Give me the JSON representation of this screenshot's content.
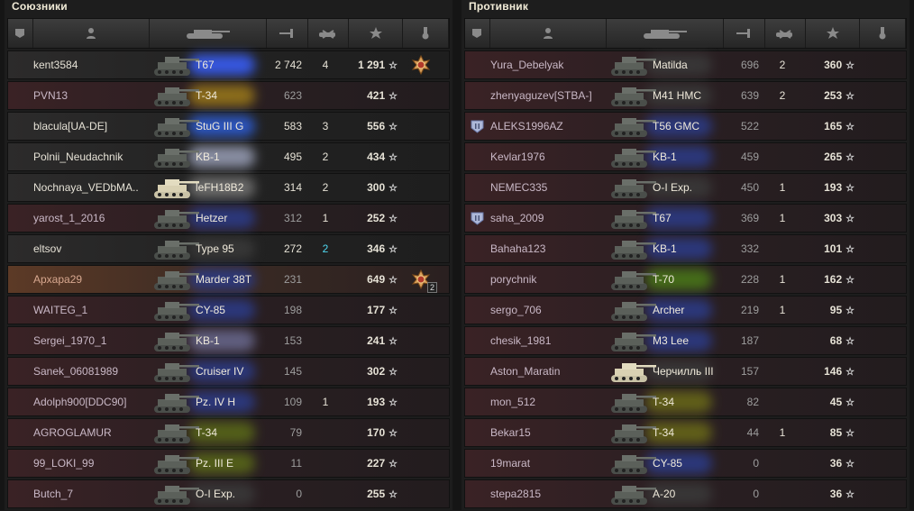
{
  "allies": {
    "title": "Союзники",
    "players": [
      {
        "name": "kent3584",
        "tank": "T67",
        "damage": "2 742",
        "frags": "4",
        "exp": "1 291",
        "style": "dark",
        "glow": "#3a60ff",
        "medal": "order",
        "medal_count": ""
      },
      {
        "name": "PVN13",
        "tank": "T-34",
        "damage": "623",
        "frags": "",
        "exp": "421",
        "style": "alt",
        "glow": "#9c7a1a",
        "medal": "",
        "medal_count": ""
      },
      {
        "name": "blacula[UA-DE]",
        "tank": "StuG III G",
        "damage": "583",
        "frags": "3",
        "exp": "556",
        "style": "dark",
        "glow": "#2e5ed8",
        "medal": "",
        "medal_count": ""
      },
      {
        "name": "Polnii_Neudachnik",
        "tank": "KB-1",
        "damage": "495",
        "frags": "2",
        "exp": "434",
        "style": "dark",
        "glow": "#9aa0b8",
        "medal": "",
        "medal_count": ""
      },
      {
        "name": "Nochnaya_VEDbMA..",
        "tank": "leFH18B2",
        "damage": "314",
        "frags": "2",
        "exp": "300",
        "style": "dark",
        "glow": "#777",
        "medal": "",
        "medal_count": ""
      },
      {
        "name": "yarost_1_2016",
        "tank": "Hetzer",
        "damage": "312",
        "frags": "1",
        "exp": "252",
        "style": "alt",
        "glow": "#2c3c8a",
        "medal": "",
        "medal_count": ""
      },
      {
        "name": "eltsov",
        "tank": "Type 95",
        "damage": "272",
        "frags": "2",
        "exp": "346",
        "style": "dark",
        "glow": "#3a3a3a",
        "medal": "",
        "medal_count": "",
        "frags_hl": true
      },
      {
        "name": "Apxapa29",
        "tank": "Marder 38T",
        "damage": "231",
        "frags": "",
        "exp": "649",
        "style": "self",
        "glow": "#2c3c8a",
        "medal": "order",
        "medal_count": "2"
      },
      {
        "name": "WAITEG_1",
        "tank": "CY-85",
        "damage": "198",
        "frags": "",
        "exp": "177",
        "style": "alt",
        "glow": "#2c3c8a",
        "medal": "",
        "medal_count": ""
      },
      {
        "name": "Sergei_1970_1",
        "tank": "KB-1",
        "damage": "153",
        "frags": "",
        "exp": "241",
        "style": "alt",
        "glow": "#6a6a90",
        "medal": "",
        "medal_count": ""
      },
      {
        "name": "Sanek_06081989",
        "tank": "Cruiser IV",
        "damage": "145",
        "frags": "",
        "exp": "302",
        "style": "alt",
        "glow": "#2c3c8a",
        "medal": "",
        "medal_count": ""
      },
      {
        "name": "Adolph900[DDC90]",
        "tank": "Pz. IV H",
        "damage": "109",
        "frags": "1",
        "exp": "193",
        "style": "alt",
        "glow": "#2c3c8a",
        "medal": "",
        "medal_count": ""
      },
      {
        "name": "AGROGLAMUR",
        "tank": "T-34",
        "damage": "79",
        "frags": "",
        "exp": "170",
        "style": "alt",
        "glow": "#5a6a18",
        "medal": "",
        "medal_count": ""
      },
      {
        "name": "99_LOKI_99",
        "tank": "Pz. III E",
        "damage": "11",
        "frags": "",
        "exp": "227",
        "style": "alt",
        "glow": "#5a6a18",
        "medal": "",
        "medal_count": ""
      },
      {
        "name": "Butch_7",
        "tank": "O-I Exp.",
        "damage": "0",
        "frags": "",
        "exp": "255",
        "style": "alt",
        "glow": "#3a3a3a",
        "medal": "",
        "medal_count": ""
      }
    ]
  },
  "enemies": {
    "title": "Противник",
    "players": [
      {
        "name": "Yura_Debelyak",
        "tank": "Matilda",
        "damage": "696",
        "frags": "2",
        "exp": "360",
        "style": "alt",
        "glow": "#3a3a3a",
        "platoon": false
      },
      {
        "name": "zhenyaguzev[STBA-]",
        "tank": "M41 HMC",
        "damage": "639",
        "frags": "2",
        "exp": "253",
        "style": "alt",
        "glow": "#3a3a3a",
        "platoon": false
      },
      {
        "name": "ALEKS1996AZ",
        "tank": "T56 GMC",
        "damage": "522",
        "frags": "",
        "exp": "165",
        "style": "alt",
        "glow": "#2c3c8a",
        "platoon": true
      },
      {
        "name": "Kevlar1976",
        "tank": "KB-1",
        "damage": "459",
        "frags": "",
        "exp": "265",
        "style": "alt",
        "glow": "#2c3c8a",
        "platoon": false
      },
      {
        "name": "NEMEC335",
        "tank": "O-I Exp.",
        "damage": "450",
        "frags": "1",
        "exp": "193",
        "style": "alt",
        "glow": "#3a3a3a",
        "platoon": false
      },
      {
        "name": "saha_2009",
        "tank": "T67",
        "damage": "369",
        "frags": "1",
        "exp": "303",
        "style": "alt",
        "glow": "#2c3c8a",
        "platoon": true
      },
      {
        "name": "Bahaha123",
        "tank": "KB-1",
        "damage": "332",
        "frags": "",
        "exp": "101",
        "style": "alt",
        "glow": "#2c3c8a",
        "platoon": false
      },
      {
        "name": "porychnik",
        "tank": "T-70",
        "damage": "228",
        "frags": "1",
        "exp": "162",
        "style": "alt",
        "glow": "#4a7a18",
        "platoon": false
      },
      {
        "name": "sergo_706",
        "tank": "Archer",
        "damage": "219",
        "frags": "1",
        "exp": "95",
        "style": "alt",
        "glow": "#2c3c8a",
        "platoon": false
      },
      {
        "name": "chesik_1981",
        "tank": "M3 Lee",
        "damage": "187",
        "frags": "",
        "exp": "68",
        "style": "alt",
        "glow": "#2c3c8a",
        "platoon": false
      },
      {
        "name": "Aston_Maratin",
        "tank": "Черчилль III",
        "damage": "157",
        "frags": "",
        "exp": "146",
        "style": "alt",
        "glow": "#3a3a3a",
        "platoon": false
      },
      {
        "name": "mon_512",
        "tank": "T-34",
        "damage": "82",
        "frags": "",
        "exp": "45",
        "style": "alt",
        "glow": "#6a6a18",
        "platoon": false
      },
      {
        "name": "Bekar15",
        "tank": "T-34",
        "damage": "44",
        "frags": "1",
        "exp": "85",
        "style": "alt",
        "glow": "#6a6a18",
        "platoon": false
      },
      {
        "name": "19marat",
        "tank": "CY-85",
        "damage": "0",
        "frags": "",
        "exp": "36",
        "style": "alt",
        "glow": "#2c3c8a",
        "platoon": false
      },
      {
        "name": "stepa2815",
        "tank": "A-20",
        "damage": "0",
        "frags": "",
        "exp": "36",
        "style": "alt",
        "glow": "#3a3a3a",
        "platoon": false
      }
    ]
  },
  "header_icons": [
    "squad-icon",
    "player-icon",
    "tank-icon",
    "damage-icon",
    "kills-icon",
    "experience-icon",
    "medal-icon"
  ],
  "colors": {
    "allied_row": "#2c2b2b",
    "enemy_row": "#3a2225",
    "own_row": "#5c3a26",
    "star": "#dddddd",
    "frags_highlight": "#4fd7ef"
  }
}
